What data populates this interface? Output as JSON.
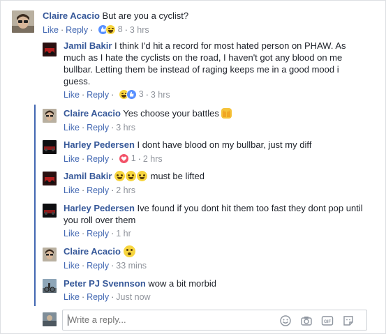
{
  "thread": {
    "comments": [
      {
        "author": "Claire Acacio",
        "text": "But are you a cyclist?",
        "actions": {
          "like": "Like",
          "reply": "Reply",
          "reaction_count": "8",
          "time": "3 hrs"
        },
        "reactions": [
          "like-icon",
          "haha-icon"
        ]
      }
    ],
    "replies": [
      {
        "author": "Jamil Bakir",
        "text": "I think I'd hit a record for most hated person on PHAW. As much as I hate the cyclists on the road, I haven't got any blood on me bullbar. Letting them be instead of raging keeps me in a good mood i guess.",
        "actions": {
          "like": "Like",
          "reply": "Reply",
          "reaction_count": "3",
          "time": "3 hrs"
        },
        "reactions": [
          "haha-icon",
          "like-icon"
        ]
      },
      {
        "author": "Claire Acacio",
        "text": "Yes choose your battles",
        "emoji": "raised-hands-icon",
        "actions": {
          "like": "Like",
          "reply": "Reply",
          "time": "3 hrs"
        }
      },
      {
        "author": "Harley Pedersen",
        "text": "I dont have blood on my bullbar, just my diff",
        "actions": {
          "like": "Like",
          "reply": "Reply",
          "reaction_count": "1",
          "time": "2 hrs"
        },
        "reactions": [
          "love-icon"
        ]
      },
      {
        "author": "Jamil Bakir",
        "text": "must be lifted",
        "emoji": "laughing-tears-icon",
        "actions": {
          "like": "Like",
          "reply": "Reply",
          "time": "2 hrs"
        }
      },
      {
        "author": "Harley Pedersen",
        "text": "Ive found if you dont hit them too fast they dont pop until you roll over them",
        "actions": {
          "like": "Like",
          "reply": "Reply",
          "time": "1 hr"
        }
      },
      {
        "author": "Claire Acacio",
        "text": "",
        "emoji": "surprised-face-icon",
        "actions": {
          "like": "Like",
          "reply": "Reply",
          "time": "33 mins"
        }
      },
      {
        "author": "Peter PJ Svennson",
        "text": "wow a bit morbid",
        "actions": {
          "like": "Like",
          "reply": "Reply",
          "time": "Just now"
        }
      }
    ]
  },
  "composer": {
    "placeholder": "Write a reply...",
    "icons": [
      "emoji-icon",
      "camera-icon",
      "gif-icon",
      "sticker-icon"
    ]
  },
  "colors": {
    "author": "#365899",
    "link": "#4267b2",
    "meta": "#90949c",
    "thread_line": "#4267b2",
    "like": "#5890ff",
    "love": "#f25268",
    "haha": "#f7d53f"
  }
}
